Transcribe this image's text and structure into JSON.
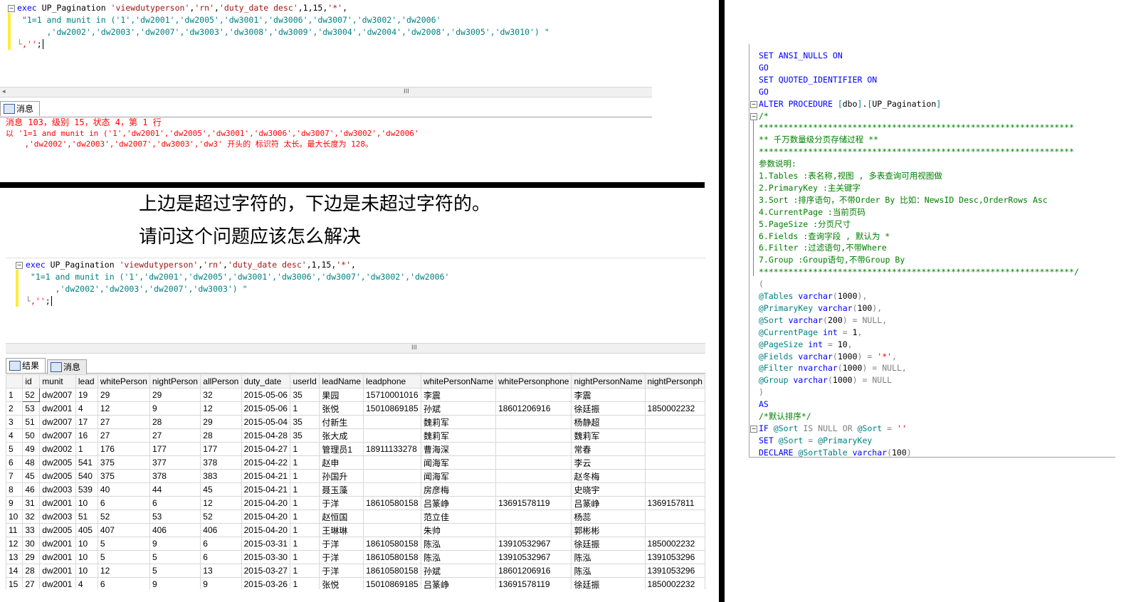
{
  "top_query": {
    "lines": [
      "exec UP_Pagination 'viewdutyperson','rn','duty_date desc',1,15,'*',",
      " \"1=1 and munit in ('1','dw2001','dw2005','dw3001','dw3006','dw3007','dw3002','dw2006'",
      "      ,'dw2002','dw2003','dw2007','dw3003','dw3008','dw3009','dw3004','dw2004','dw2008','dw3005','dw3010') \"",
      " ,'';"
    ],
    "scroll_grip": "III"
  },
  "messages_panel": {
    "tab_label": "消息",
    "lines": [
      "消息 103，级别 15，状态 4，第 1 行",
      "以 '1=1 and munit in ('1','dw2001','dw2005','dw3001','dw3006','dw3007','dw3002','dw2006'",
      "    ,'dw2002','dw2003','dw2007','dw3003','dw3' 开头的 标识符 太长。最大长度为 128。"
    ]
  },
  "captions": {
    "line1": "上边是超过字符的，下边是未超过字符的。",
    "line2": "请问这个问题应该怎么解决"
  },
  "bottom_query": {
    "lines": [
      "exec UP_Pagination 'viewdutyperson','rn','duty_date desc',1,15,'*',",
      " \"1=1 and munit in ('1','dw2001','dw2005','dw3001','dw3006','dw3007','dw3002','dw2006'",
      "      ,'dw2002','dw2003','dw2007','dw3003') \"",
      " ,'';"
    ],
    "scroll_grip": "III"
  },
  "results_tabs": [
    "结果",
    "消息"
  ],
  "grid": {
    "columns": [
      "",
      "id",
      "munit",
      "lead",
      "whitePerson",
      "nightPerson",
      "allPerson",
      "duty_date",
      "userId",
      "leadName",
      "leadphone",
      "whitePersonName",
      "whitePersonphone",
      "nightPersonName",
      "nightPersonph"
    ],
    "rows": [
      [
        "1",
        "52",
        "dw2007",
        "19",
        "29",
        "29",
        "32",
        "2015-05-06",
        "35",
        "果园",
        "15710001016",
        "李震",
        "",
        "李震",
        ""
      ],
      [
        "2",
        "53",
        "dw2001",
        "4",
        "12",
        "9",
        "12",
        "2015-05-06",
        "1",
        "张悦",
        "15010869185",
        "孙斌",
        "18601206916",
        "徐廷振",
        "1850002232"
      ],
      [
        "3",
        "51",
        "dw2007",
        "17",
        "27",
        "28",
        "29",
        "2015-05-04",
        "35",
        "付新生",
        "",
        "魏莉军",
        "",
        "杨静超",
        ""
      ],
      [
        "4",
        "50",
        "dw2007",
        "16",
        "27",
        "27",
        "28",
        "2015-04-28",
        "35",
        "张大成",
        "",
        "魏莉军",
        "",
        "魏莉军",
        ""
      ],
      [
        "5",
        "49",
        "dw2002",
        "1",
        "176",
        "177",
        "177",
        "2015-04-27",
        "1",
        "管理员1",
        "18911133278",
        "曹海深",
        "",
        "常春",
        ""
      ],
      [
        "6",
        "48",
        "dw2005",
        "541",
        "375",
        "377",
        "378",
        "2015-04-22",
        "1",
        "赵申",
        "",
        "闻海军",
        "",
        "李云",
        ""
      ],
      [
        "7",
        "45",
        "dw2005",
        "540",
        "375",
        "378",
        "383",
        "2015-04-21",
        "1",
        "孙国升",
        "",
        "闻海军",
        "",
        "赵冬梅",
        ""
      ],
      [
        "8",
        "46",
        "dw2003",
        "539",
        "40",
        "44",
        "45",
        "2015-04-21",
        "1",
        "聂玉藻",
        "",
        "房彦梅",
        "",
        "史晓宇",
        ""
      ],
      [
        "9",
        "31",
        "dw2001",
        "10",
        "6",
        "6",
        "12",
        "2015-04-20",
        "1",
        "于洋",
        "18610580158",
        "吕篆峥",
        "13691578119",
        "吕篆峥",
        "1369157811"
      ],
      [
        "10",
        "32",
        "dw2003",
        "51",
        "52",
        "53",
        "52",
        "2015-04-20",
        "1",
        "赵恒国",
        "",
        "范立佳",
        "",
        "杨蕊",
        ""
      ],
      [
        "11",
        "33",
        "dw2005",
        "405",
        "407",
        "406",
        "406",
        "2015-04-20",
        "1",
        "王琳琳",
        "",
        "朱帅",
        "",
        "郭彬彬",
        ""
      ],
      [
        "12",
        "30",
        "dw2001",
        "10",
        "5",
        "9",
        "6",
        "2015-03-31",
        "1",
        "于洋",
        "18610580158",
        "陈泓",
        "13910532967",
        "徐廷振",
        "1850002232"
      ],
      [
        "13",
        "29",
        "dw2001",
        "10",
        "5",
        "5",
        "6",
        "2015-03-30",
        "1",
        "于洋",
        "18610580158",
        "陈泓",
        "13910532967",
        "陈泓",
        "1391053296"
      ],
      [
        "14",
        "28",
        "dw2001",
        "10",
        "12",
        "5",
        "13",
        "2015-03-27",
        "1",
        "于洋",
        "18610580158",
        "孙斌",
        "18601206916",
        "陈泓",
        "1391053296"
      ],
      [
        "15",
        "27",
        "dw2001",
        "4",
        "6",
        "9",
        "9",
        "2015-03-26",
        "1",
        "张悦",
        "15010869185",
        "吕篆峥",
        "13691578119",
        "徐廷振",
        "1850002232"
      ]
    ]
  },
  "procedure": {
    "lines": [
      "SET ANSI_NULLS ON",
      "GO",
      "SET QUOTED_IDENTIFIER ON",
      "GO",
      "ALTER PROCEDURE [dbo].[UP_Pagination]",
      "/*",
      "****************************************************************",
      "** 千万数量级分页存储过程 **",
      "****************************************************************",
      "参数说明:",
      "1.Tables :表名称,视图 , 多表查询可用视图做",
      "2.PrimaryKey :主关键字",
      "3.Sort :排序语句，不带Order By 比如：NewsID Desc,OrderRows Asc",
      "4.CurrentPage :当前页码",
      "5.PageSize :分页尺寸",
      "6.Fields :查询字段 , 默认为 *",
      "6.Filter :过滤语句,不带Where",
      "7.Group :Group语句,不带Group By",
      "****************************************************************/",
      "(",
      "@Tables varchar(1000),",
      "@PrimaryKey varchar(100),",
      "@Sort varchar(200) = NULL,",
      "@CurrentPage int = 1,",
      "@PageSize int = 10,",
      "@Fields varchar(1000) = '*',",
      "@Filter nvarchar(1000) = NULL,",
      "@Group varchar(1000) = NULL",
      ")",
      "AS",
      "/*默认排序*/",
      "IF @Sort IS NULL OR @Sort = ''",
      "SET @Sort = @PrimaryKey",
      "DECLARE @SortTable varchar(100)"
    ]
  },
  "colors": {
    "keyword": "#0000ff",
    "string": "#ff0000",
    "comment": "#008000",
    "error": "#ff0000",
    "change_bar": "#ffeb3b"
  }
}
